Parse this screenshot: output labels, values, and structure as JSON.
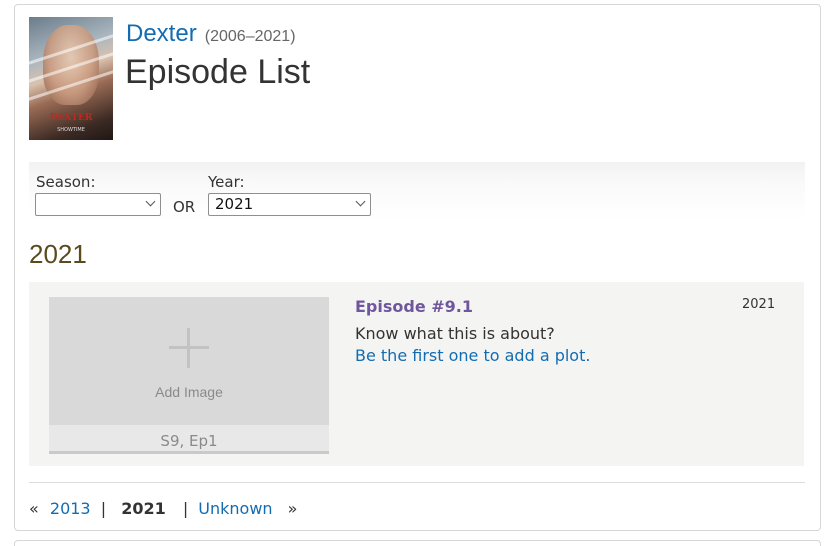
{
  "show": {
    "title": "Dexter",
    "years": "(2006–2021)",
    "poster_text": "DEXTER",
    "poster_network": "SHOWTIME"
  },
  "page_title": "Episode List",
  "filters": {
    "season_label": "Season:",
    "season_value": "",
    "or_text": "OR",
    "year_label": "Year:",
    "year_value": "2021"
  },
  "year_heading": "2021",
  "episode": {
    "image_placeholder": "Add Image",
    "tag": "S9, Ep1",
    "title": "Episode #9.1",
    "airdate": "2021",
    "plot_question": "Know what this is about?",
    "plot_link": "Be the first one to add a plot."
  },
  "pagination": {
    "prev_symbol": "«",
    "prev_year": "2013",
    "separator": "|",
    "current_year": "2021",
    "next_label": "Unknown",
    "next_symbol": "»"
  },
  "colors": {
    "link": "#136cb2",
    "episode_title": "#70579d",
    "year_heading": "#5a4a1e"
  }
}
